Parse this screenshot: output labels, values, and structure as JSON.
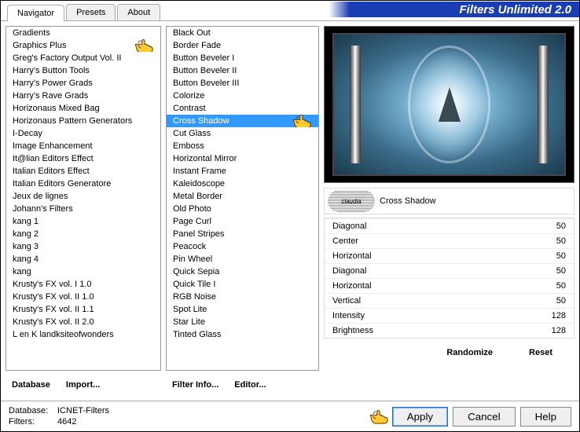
{
  "title": "Filters Unlimited 2.0",
  "tabs": {
    "navigator": "Navigator",
    "presets": "Presets",
    "about": "About"
  },
  "categories": [
    "Gradients",
    "Graphics Plus",
    "Greg's Factory Output Vol. II",
    "Harry's Button Tools",
    "Harry's Power Grads",
    "Harry's Rave Grads",
    "Horizonaus Mixed Bag",
    "Horizonaus Pattern Generators",
    "I-Decay",
    "Image Enhancement",
    "It@lian Editors Effect",
    "Italian Editors Effect",
    "Italian Editors Generatore",
    "Jeux de lignes",
    "Johann's Filters",
    "kang 1",
    "kang 2",
    "kang 3",
    "kang 4",
    "kang",
    "Krusty's FX vol. I 1.0",
    "Krusty's FX vol. II 1.0",
    "Krusty's FX vol. II 1.1",
    "Krusty's FX vol. II 2.0",
    "L en K landksiteofwonders"
  ],
  "categories_pointed_index": 1,
  "filters": [
    "Black Out",
    "Border Fade",
    "Button Beveler I",
    "Button Beveler II",
    "Button Beveler III",
    "Colorize",
    "Contrast",
    "Cross Shadow",
    "Cut Glass",
    "Emboss",
    "Horizontal Mirror",
    "Instant Frame",
    "Kaleidoscope",
    "Metal Border",
    "Old Photo",
    "Page Curl",
    "Panel Stripes",
    "Peacock",
    "Pin Wheel",
    "Quick Sepia",
    "Quick Tile I",
    "RGB Noise",
    "Spot Lite",
    "Star Lite",
    "Tinted Glass"
  ],
  "filters_selected_index": 7,
  "selected_filter_name": "Cross Shadow",
  "logo_text": "claudia",
  "params": [
    {
      "label": "Diagonal",
      "value": 50
    },
    {
      "label": "Center",
      "value": 50
    },
    {
      "label": "Horizontal",
      "value": 50
    },
    {
      "label": "Diagonal",
      "value": 50
    },
    {
      "label": "Horizontal",
      "value": 50
    },
    {
      "label": "Vertical",
      "value": 50
    },
    {
      "label": "Intensity",
      "value": 128
    },
    {
      "label": "Brightness",
      "value": 128
    }
  ],
  "buttons": {
    "database": "Database",
    "import": "Import...",
    "filter_info": "Filter Info...",
    "editor": "Editor...",
    "randomize": "Randomize",
    "reset": "Reset",
    "apply": "Apply",
    "cancel": "Cancel",
    "help": "Help"
  },
  "status": {
    "db_label": "Database:",
    "db_value": "ICNET-Filters",
    "filters_label": "Filters:",
    "filters_value": "4642"
  }
}
